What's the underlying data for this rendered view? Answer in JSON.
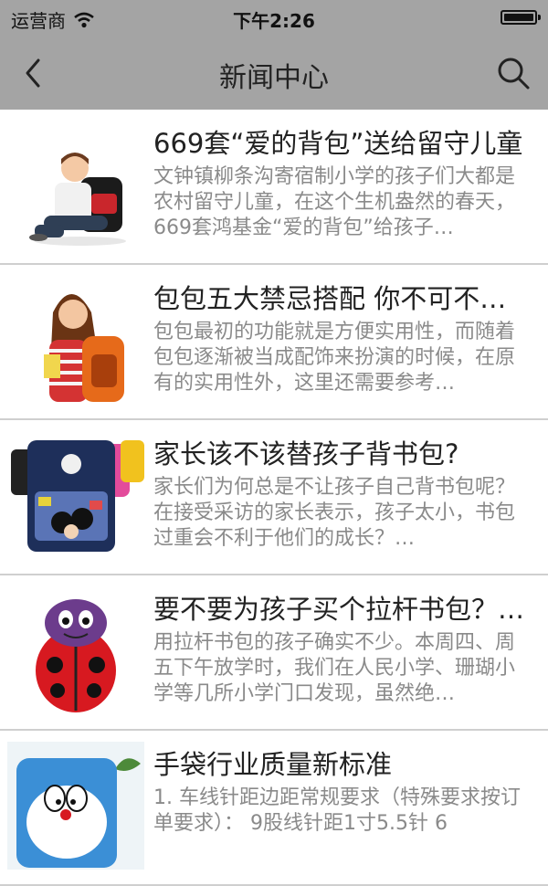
{
  "status_bar": {
    "carrier": "运营商",
    "time": "下午2:26",
    "battery_level": 1.0
  },
  "nav": {
    "title": "新闻中心",
    "back_icon": "chevron-left-icon",
    "search_icon": "search-icon"
  },
  "news": [
    {
      "title": "669套“爱的背包”送给留守儿童",
      "summary": "文钟镇柳条沟寄宿制小学的孩子们大都是农村留守儿童，在这个生机盎然的春天，669套鸿基金“爱的背包”给孩子…"
    },
    {
      "title": "包包五大禁忌搭配 你不可不…",
      "summary": "包包最初的功能就是方便实用性，而随着包包逐渐被当成配饰来扮演的时候，在原有的实用性外，这里还需要参考…"
    },
    {
      "title": "家长该不该替孩子背书包?",
      "summary": "家长们为何总是不让孩子自己背书包呢？在接受采访的家长表示，孩子太小，书包过重会不利于他们的成长？…"
    },
    {
      "title": "要不要为孩子买个拉杆书包？…",
      "summary": "用拉杆书包的孩子确实不少。本周四、周五下午放学时，我们在人民小学、珊瑚小学等几所小学门口发现，虽然绝…"
    },
    {
      "title": "手袋行业质量新标准",
      "summary": "1.  车线针距边距常规要求（特殊要求按订单要求）：  9股线针距1寸5.5针 6"
    }
  ]
}
